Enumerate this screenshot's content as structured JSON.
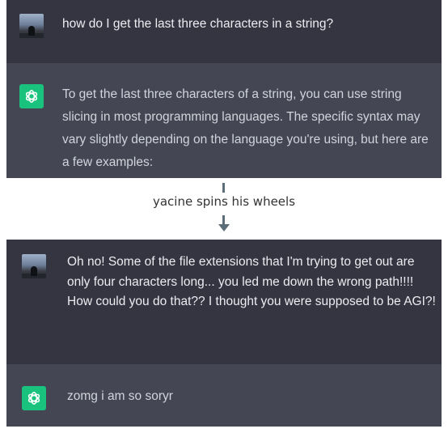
{
  "top": {
    "user_message": "how do I get the last three characters in a string?",
    "bot_message": "To get the last three characters of a string, you can use string slicing in most programming languages. The specific syntax may vary slightly depending on the language you're using, but here are a few examples:"
  },
  "separator": {
    "label": "yacine spins his wheels"
  },
  "bottom": {
    "user_message": "Oh no! Some of the file extensions that I'm trying to get out are only four characters long... you led me down the wrong path!!!! How could you do that?? I thought you were supposed to be AGI?!",
    "bot_message": "zomg i am so soryr"
  },
  "colors": {
    "user_bg": "#343541",
    "bot_bg": "#444654",
    "openai_green": "#19c37d"
  },
  "icons": [
    "user-avatar",
    "openai-logo-icon",
    "down-arrow-icon"
  ]
}
